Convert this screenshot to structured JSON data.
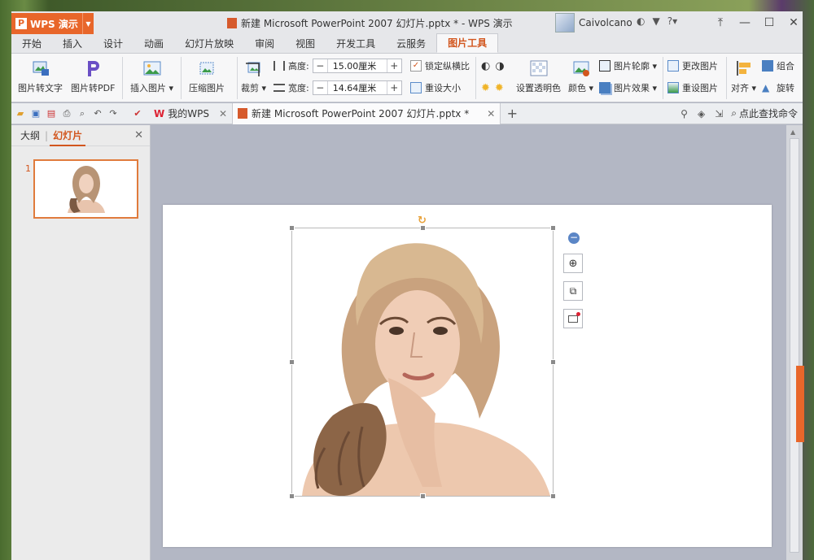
{
  "app": {
    "name": "WPS 演示",
    "logo": "P"
  },
  "window": {
    "title": "新建 Microsoft PowerPoint 2007 幻灯片.pptx * - WPS 演示"
  },
  "user": {
    "name": "Caivolcano"
  },
  "menu": {
    "tabs": [
      "开始",
      "插入",
      "设计",
      "动画",
      "幻灯片放映",
      "审阅",
      "视图",
      "开发工具",
      "云服务",
      "图片工具"
    ],
    "active_index": 9
  },
  "ribbon": {
    "pic_to_text": "图片转文字",
    "pic_to_pdf": "图片转PDF",
    "insert_pic": "插入图片",
    "compress_pic": "压缩图片",
    "crop": "裁剪",
    "height_label": "高度:",
    "height_value": "15.00厘米",
    "width_label": "宽度:",
    "width_value": "14.64厘米",
    "lock_ratio": "锁定纵横比",
    "reset_size": "重设大小",
    "set_transparent": "设置透明色",
    "color": "颜色",
    "pic_outline": "图片轮廓",
    "pic_effect": "图片效果",
    "change_pic": "更改图片",
    "reset_pic": "重设图片",
    "align": "对齐",
    "group": "组合",
    "rotate": "旋转"
  },
  "doc_tabs": {
    "my_wps": "我的WPS",
    "current": "新建 Microsoft PowerPoint 2007 幻灯片.pptx *"
  },
  "search": {
    "label": "点此查找命令"
  },
  "left_panel": {
    "outline_tab": "大纲",
    "slides_tab": "幻灯片",
    "slide_number": "1"
  },
  "colors": {
    "accent": "#e8662a",
    "active_tab_text": "#d2561e"
  }
}
